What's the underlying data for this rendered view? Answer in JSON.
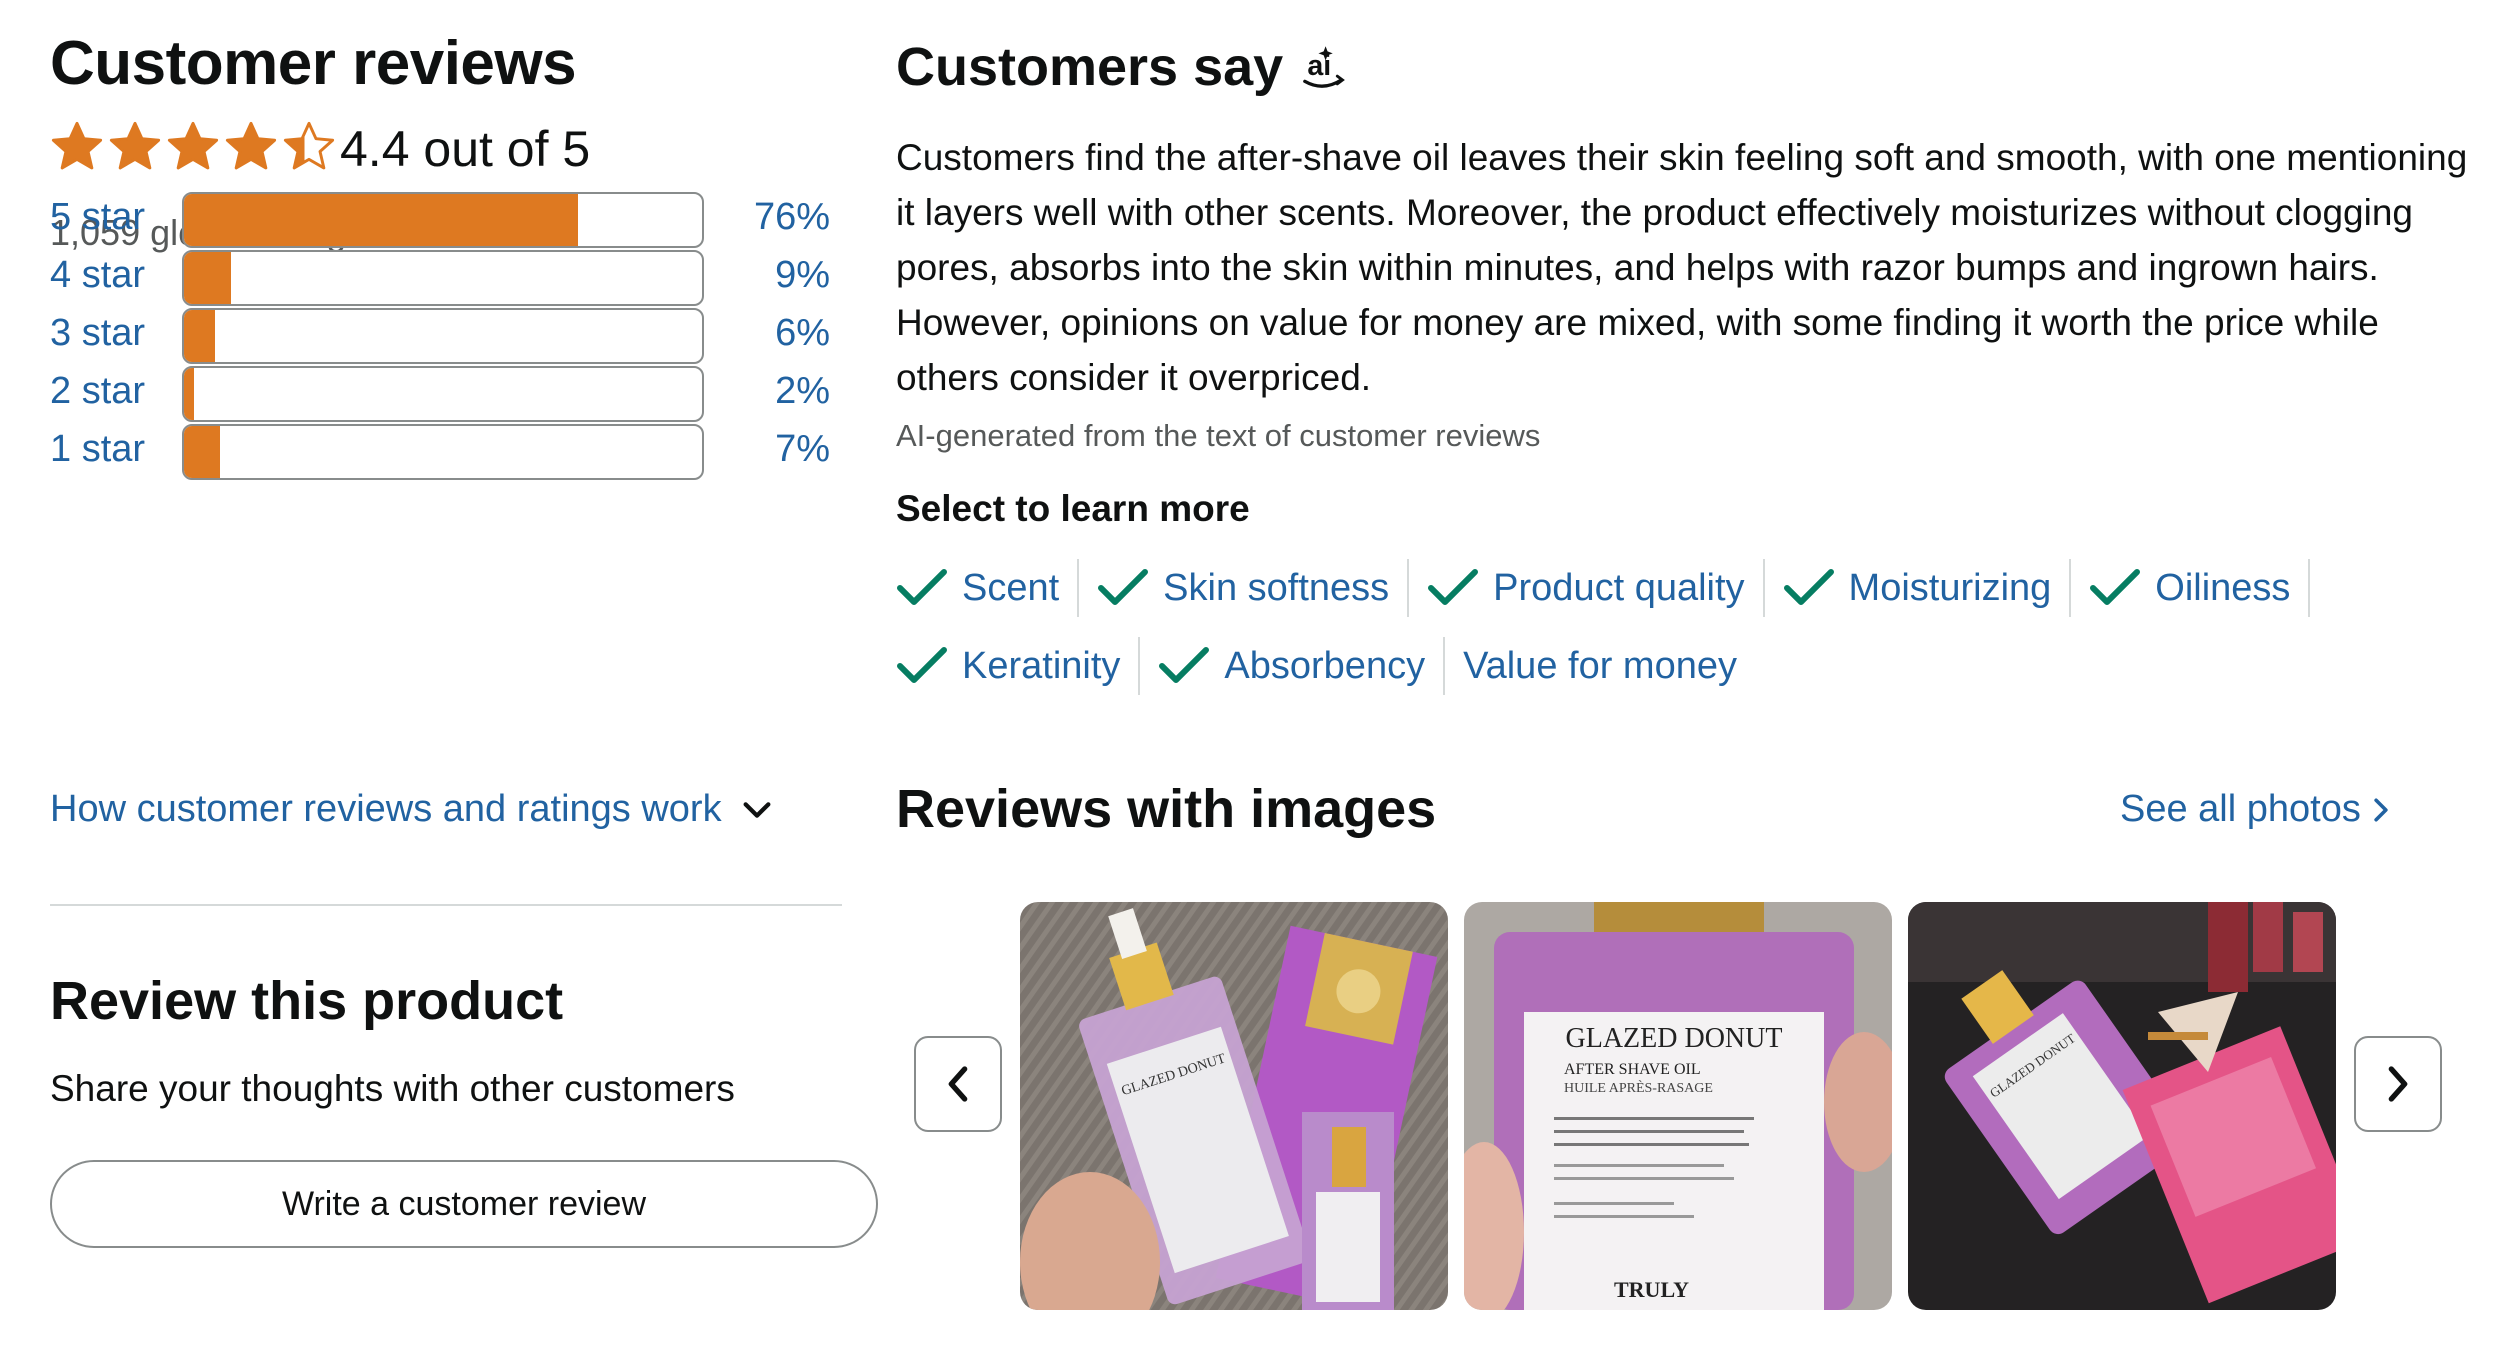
{
  "ratings": {
    "title": "Customer reviews",
    "stars_value": 4.4,
    "rating_text": "4.4 out of 5",
    "global_ratings": "1,059 global ratings",
    "histogram": [
      {
        "label": "5 star",
        "pct": "76%",
        "fraction": 0.76
      },
      {
        "label": "4 star",
        "pct": "9%",
        "fraction": 0.09
      },
      {
        "label": "3 star",
        "pct": "6%",
        "fraction": 0.06
      },
      {
        "label": "2 star",
        "pct": "2%",
        "fraction": 0.02
      },
      {
        "label": "1 star",
        "pct": "7%",
        "fraction": 0.07
      }
    ],
    "how_link": "How customer reviews and ratings work",
    "colors": {
      "star": "#de7921",
      "link": "#2162a1"
    }
  },
  "review_product": {
    "title": "Review this product",
    "subtitle": "Share your thoughts with other customers",
    "button_label": "Write a customer review"
  },
  "customers_say": {
    "title": "Customers say",
    "summary": "Customers find the after-shave oil leaves their skin feeling soft and smooth, with one mentioning it layers well with other scents. Moreover, the product effectively moisturizes without clogging pores, absorbs into the skin within minutes, and helps with razor bumps and ingrown hairs. However, opinions on value for money are mixed, with some finding it worth the price while others consider it overpriced.",
    "ai_note": "AI-generated from the text of customer reviews",
    "select_title": "Select to learn more",
    "aspects": [
      {
        "label": "Scent",
        "positive": true
      },
      {
        "label": "Skin softness",
        "positive": true
      },
      {
        "label": "Product quality",
        "positive": true
      },
      {
        "label": "Moisturizing",
        "positive": true
      },
      {
        "label": "Oiliness",
        "positive": true
      },
      {
        "label": "Keratinity",
        "positive": true
      },
      {
        "label": "Absorbency",
        "positive": true
      },
      {
        "label": "Value for money",
        "positive": false
      }
    ],
    "check_color": "#067d62"
  },
  "reviews_with_images": {
    "title": "Reviews with images",
    "see_all": "See all photos",
    "photos": [
      {
        "brand_text": "GLAZED DONUT"
      },
      {
        "label_line1": "GLAZED DONUT",
        "label_line2": "AFTER SHAVE OIL",
        "label_line3": "HUILE APRÈS-RASAGE",
        "brand_text": "TRULY"
      },
      {
        "brand_text": "GLAZED DONUT"
      }
    ]
  }
}
